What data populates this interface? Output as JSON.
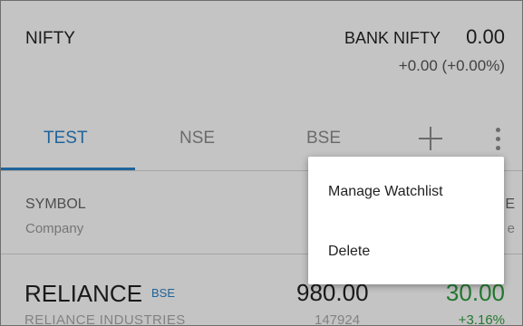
{
  "header": {
    "index_left": "NIFTY",
    "index_right_name": "BANK NIFTY",
    "index_right_value": "0.00",
    "index_right_change": "+0.00 (+0.00%)"
  },
  "tabs": [
    {
      "label": "TEST",
      "active": true
    },
    {
      "label": "NSE",
      "active": false
    },
    {
      "label": "BSE",
      "active": false
    }
  ],
  "tab_actions": {
    "add_icon": "plus-icon",
    "more_icon": "more-vertical-icon"
  },
  "columns": {
    "symbol": "SYMBOL",
    "company": "Company",
    "right_line_1": "E",
    "right_line_2": "e"
  },
  "stocks": [
    {
      "symbol": "RELIANCE",
      "exchange": "BSE",
      "company": "RELIANCE INDUSTRIES",
      "price": "980.00",
      "volume": "147924",
      "change": "30.00",
      "change_pct": "+3.16%"
    }
  ],
  "menu": {
    "items": [
      {
        "label": "Manage Watchlist"
      },
      {
        "label": "Delete"
      }
    ]
  },
  "colors": {
    "accent": "#2a83c9",
    "positive": "#2e9e3e",
    "overlay": "rgba(0,0,0,0.23)"
  }
}
